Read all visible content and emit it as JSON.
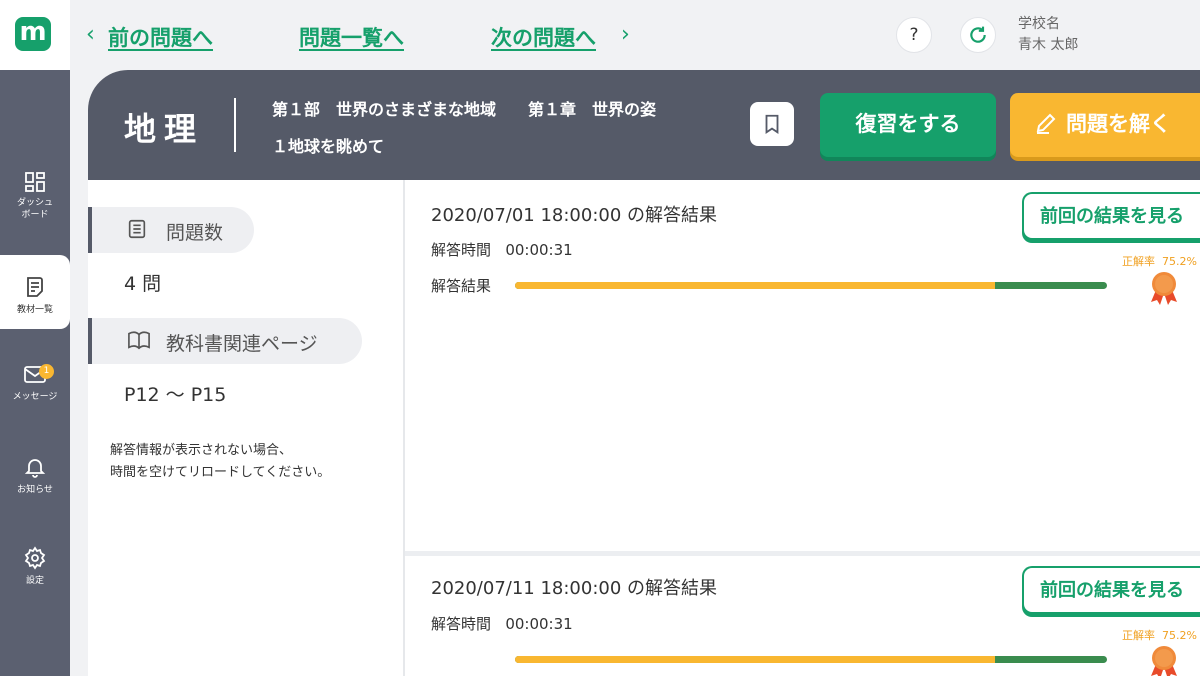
{
  "app": {
    "logo_letter": "m"
  },
  "sidebar": {
    "items": [
      {
        "label_line1": "ダッシュ",
        "label_line2": "ボード",
        "icon": "dashboard-icon"
      },
      {
        "label": "教材一覧",
        "icon": "textbook-icon",
        "active": true
      },
      {
        "label": "メッセージ",
        "icon": "mail-icon",
        "badge": "1"
      },
      {
        "label": "お知らせ",
        "icon": "bell-icon"
      },
      {
        "label": "設定",
        "icon": "gear-icon"
      }
    ]
  },
  "topnav": {
    "prev": "前の問題へ",
    "list": "問題一覧へ",
    "next": "次の問題へ",
    "help": "?"
  },
  "user": {
    "school": "学校名",
    "name": "青木 太郎"
  },
  "header": {
    "subject": "地理",
    "chapter_line1": "第１部　世界のさまざまな地域　　第１章　世界の姿",
    "chapter_line2": "１地球を眺めて",
    "review_label": "復習をする",
    "solve_label": "問題を解く"
  },
  "info": {
    "question_count_label": "問題数",
    "question_count": "4 問",
    "textbook_label": "教科書関連ページ",
    "textbook_pages": "P12 ～ P15",
    "note_line1": "解答情報が表示されない場合、",
    "note_line2": "時間を空けてリロードしてください。"
  },
  "results": [
    {
      "title": "2020/07/01 18:00:00 の解答結果",
      "time_label": "解答時間",
      "time": "00:00:31",
      "result_label": "解答結果",
      "rate_label": "正解率",
      "rate": "75.2%",
      "progress": 0.81,
      "prev_button": "前回の結果を見る"
    },
    {
      "title": "2020/07/11 18:00:00 の解答結果",
      "time_label": "解答時間",
      "time": "00:00:31",
      "result_label": "解答結果",
      "rate_label": "正解率",
      "rate": "75.2%",
      "progress": 0.81,
      "prev_button": "前回の結果を見る"
    }
  ],
  "colors": {
    "brand_green": "#16a06b",
    "accent_yellow": "#f9b731",
    "header_gray": "#555a68",
    "bar_green": "#3a8c4e"
  }
}
